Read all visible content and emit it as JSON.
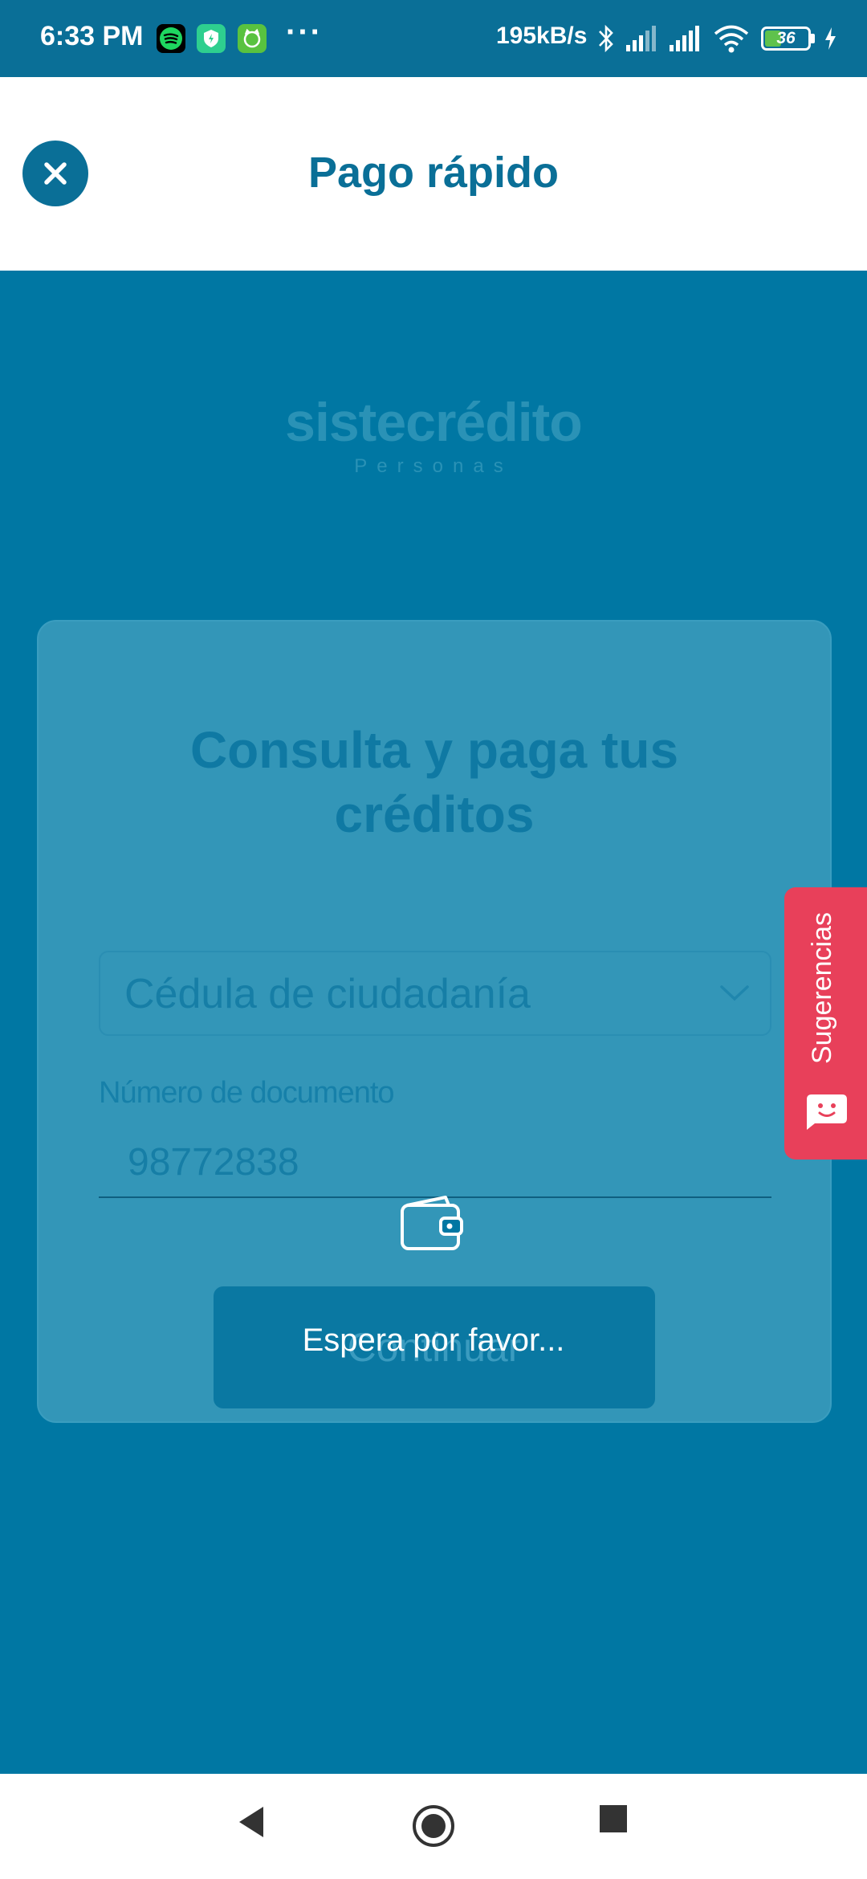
{
  "status_bar": {
    "time": "6:33 PM",
    "dots": "···",
    "net_speed": "195kB/s",
    "battery": "36",
    "icons": [
      "spotify-icon",
      "shield-icon",
      "cat-app-icon",
      "bluetooth-icon",
      "signal-icon",
      "signal-icon",
      "wifi-icon",
      "battery-icon",
      "charging-icon"
    ]
  },
  "header": {
    "title": "Pago rápido",
    "close_icon": "close-icon"
  },
  "logo": {
    "name": "sistecrédito",
    "subtitle": "Personas"
  },
  "form": {
    "title": "Consulta y paga tus créditos",
    "document_type": "Cédula de ciudadanía",
    "document_label": "Número de documento",
    "document_value": "98772838",
    "continue_label": "Continuar"
  },
  "loading": {
    "icon": "wallet-icon",
    "text": "Espera por favor..."
  },
  "feedback_tab": {
    "label": "Sugerencias",
    "icon": "chat-bubble-icon"
  },
  "colors": {
    "primary": "#0077a3",
    "header_text": "#0a6f97",
    "feedback": "#e8405a"
  }
}
